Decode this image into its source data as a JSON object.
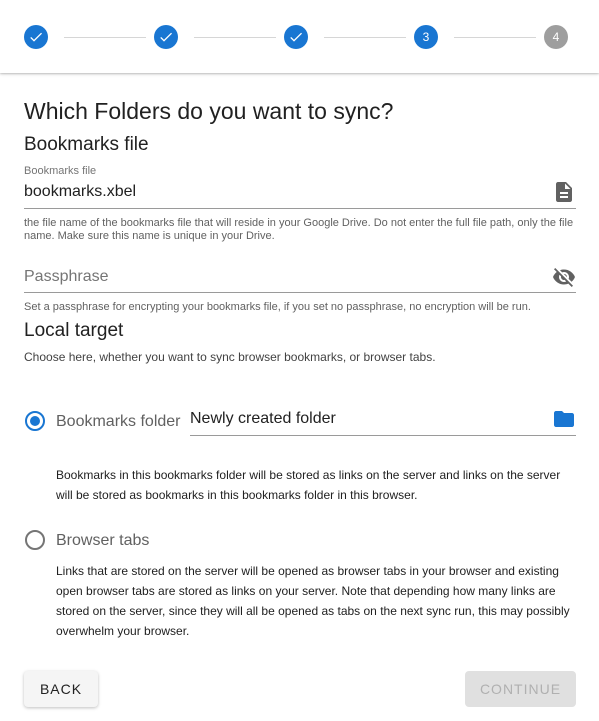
{
  "stepper": {
    "steps": [
      {
        "label": "",
        "state": "done"
      },
      {
        "label": "",
        "state": "done"
      },
      {
        "label": "",
        "state": "done"
      },
      {
        "label": "3",
        "state": "active"
      },
      {
        "label": "4",
        "state": "todo"
      }
    ]
  },
  "page_title": "Which Folders do you want to sync?",
  "bookmarks_file_section": {
    "heading": "Bookmarks file",
    "field_label": "Bookmarks file",
    "field_value": "bookmarks.xbel",
    "field_icon": "file-document-icon",
    "helper": "the file name of the bookmarks file that will reside in your Google Drive. Do not enter the full file path, only the file name. Make sure this name is unique in your Drive."
  },
  "passphrase": {
    "placeholder": "Passphrase",
    "icon": "eye-off-icon",
    "helper": "Set a passphrase for encrypting your bookmarks file, if you set no passphrase, no encryption will be run."
  },
  "local_target": {
    "heading": "Local target",
    "description": "Choose here, whether you want to sync browser bookmarks, or browser tabs.",
    "options": [
      {
        "label": "Bookmarks folder",
        "selected": true,
        "folder_value": "Newly created folder",
        "folder_icon": "folder-icon",
        "description": "Bookmarks in this bookmarks folder will be stored as links on the server and links on the server will be stored as bookmarks in this bookmarks folder in this browser."
      },
      {
        "label": "Browser tabs",
        "selected": false,
        "description": "Links that are stored on the server will be opened as browser tabs in your browser and existing open browser tabs are stored as links on your server. Note that depending how many links are stored on the server, since they will all be opened as tabs on the next sync run, this may possibly overwhelm your browser."
      }
    ]
  },
  "buttons": {
    "back": "BACK",
    "continue": "CONTINUE"
  },
  "colors": {
    "accent": "#1976d2",
    "inactive_step": "#9e9e9e",
    "disabled_button": "#e0e0e0"
  }
}
